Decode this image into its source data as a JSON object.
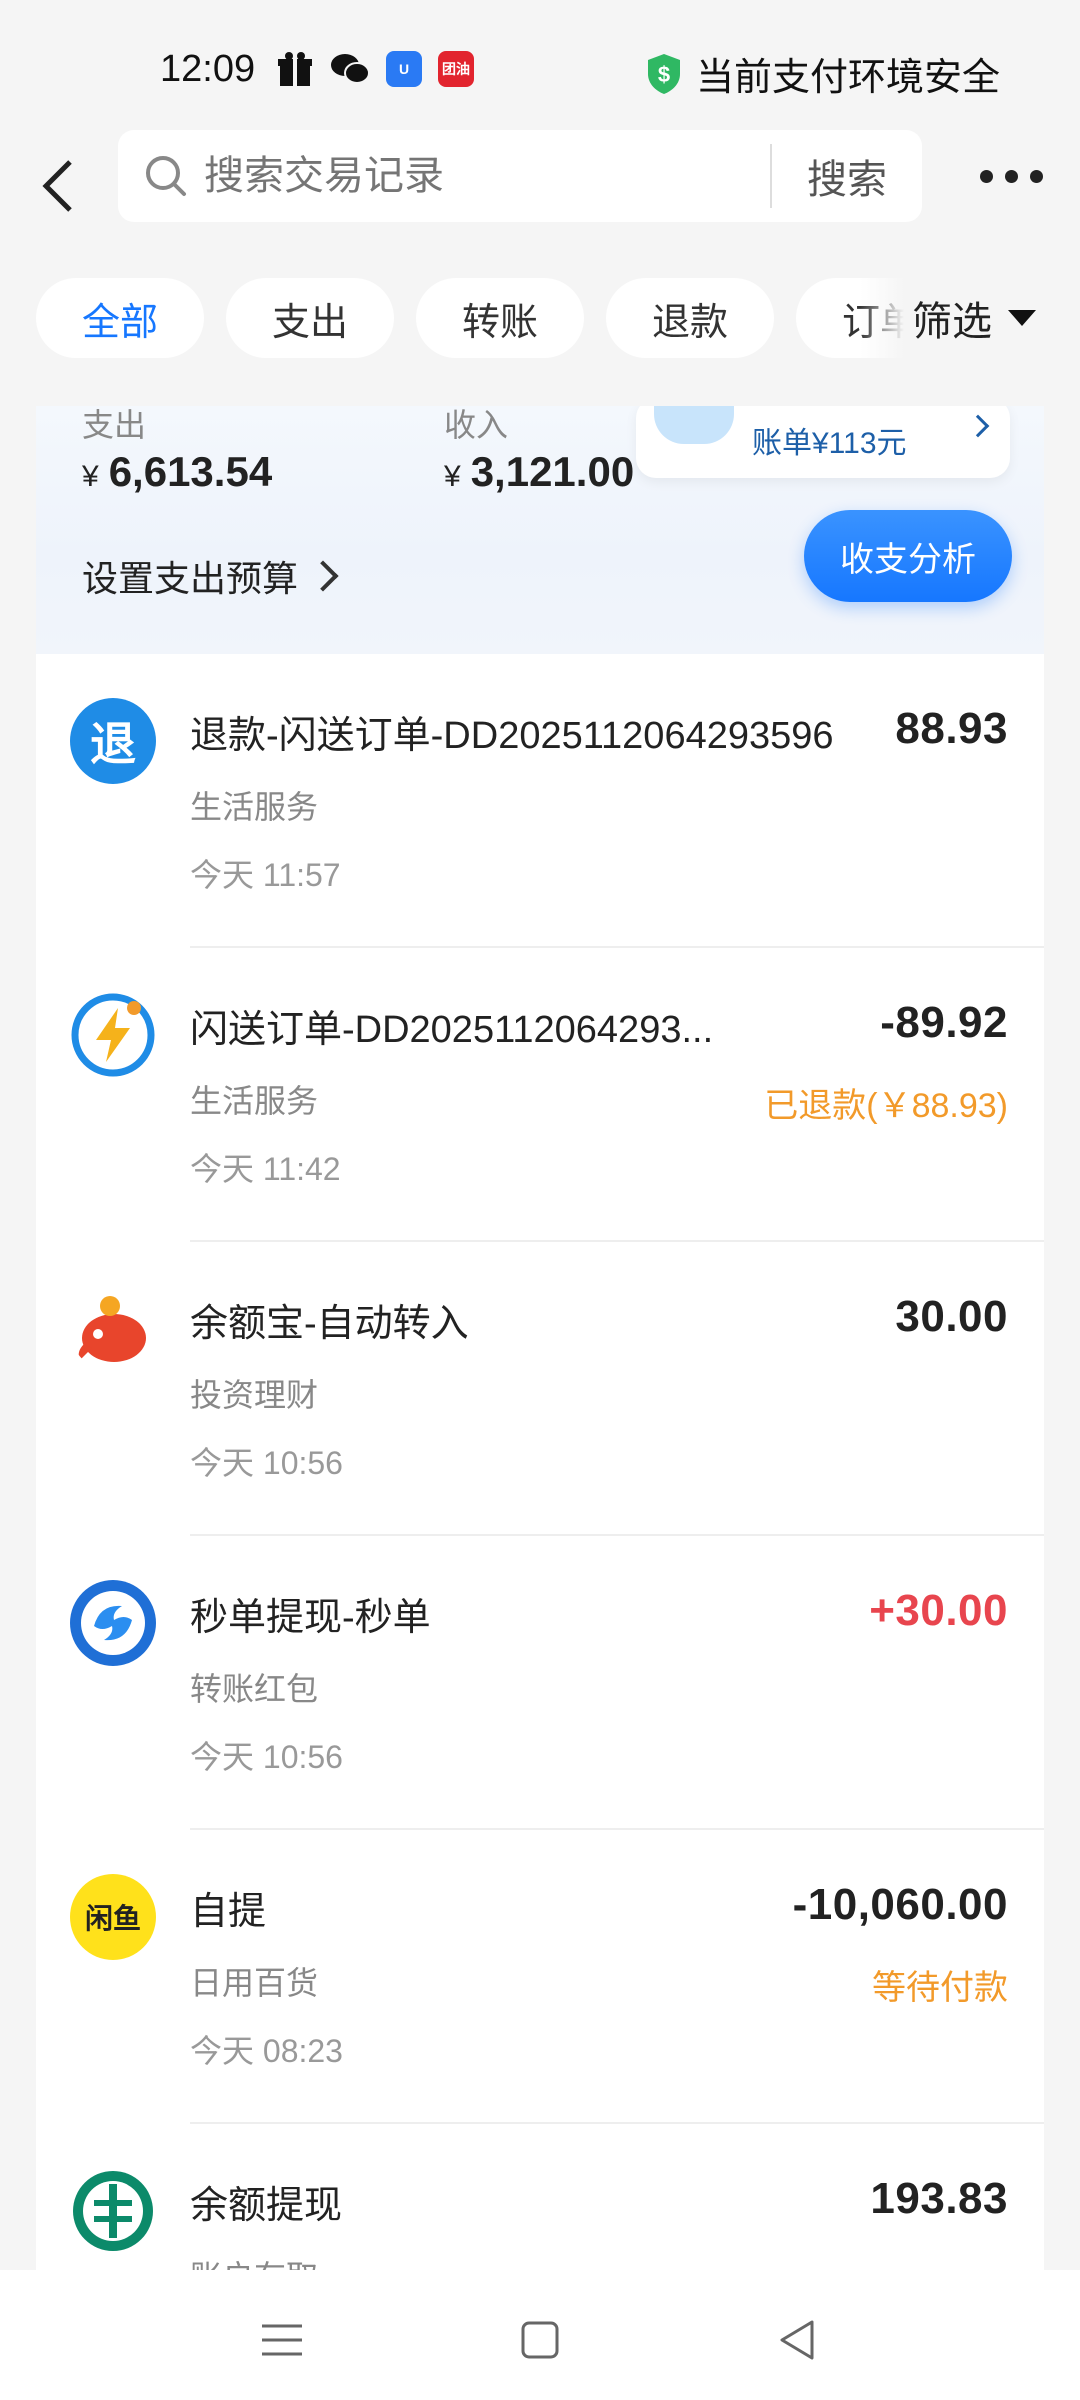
{
  "status_bar": {
    "time": "12:09",
    "icons": [
      "gift-icon",
      "wechat-icon",
      "app-icon",
      "tuanyou-icon"
    ],
    "tuanyou_label": "团油",
    "safety_text": "当前支付环境安全",
    "safety_color": "#2fb863"
  },
  "header": {
    "search_placeholder": "搜索交易记录",
    "search_button": "搜索"
  },
  "tabs": [
    {
      "label": "全部",
      "active": true
    },
    {
      "label": "支出",
      "active": false
    },
    {
      "label": "转账",
      "active": false
    },
    {
      "label": "退款",
      "active": false
    },
    {
      "label": "订单",
      "active": false
    }
  ],
  "filter_label": "筛选",
  "summary": {
    "expense_label": "支出",
    "expense_value": "6,613.54",
    "income_label": "收入",
    "income_value": "3,121.00",
    "currency": "¥",
    "budget_label": "设置支出预算",
    "tip_text": "账单¥113元",
    "analysis_button": "收支分析"
  },
  "transactions": [
    {
      "icon": "refund-icon",
      "icon_text": "退",
      "title": "退款-闪送订单-DD2025112064293596",
      "category": "生活服务",
      "time": "今天 11:57",
      "amount": "88.93",
      "status": "",
      "amount_color": "default"
    },
    {
      "icon": "flash-delivery-icon",
      "title": "闪送订单-DD2025112064293...",
      "category": "生活服务",
      "time": "今天 11:42",
      "amount": "-89.92",
      "status": "已退款(￥88.93)",
      "amount_color": "default"
    },
    {
      "icon": "yuebao-icon",
      "title": "余额宝-自动转入",
      "category": "投资理财",
      "time": "今天 10:56",
      "amount": "30.00",
      "status": "",
      "amount_color": "default"
    },
    {
      "icon": "miaodan-icon",
      "title": "秒单提现-秒单",
      "category": "转账红包",
      "time": "今天 10:56",
      "amount": "+30.00",
      "status": "",
      "amount_color": "red"
    },
    {
      "icon": "xianyu-icon",
      "icon_text": "闲鱼",
      "title": "自提",
      "category": "日用百货",
      "time": "今天 08:23",
      "amount": "-10,060.00",
      "status": "等待付款",
      "amount_color": "default"
    },
    {
      "icon": "abc-bank-icon",
      "title": "余额提现",
      "category": "账户存取",
      "time": "",
      "amount": "193.83",
      "status": "",
      "amount_color": "default"
    }
  ],
  "colors": {
    "accent": "#1677ff",
    "income_red": "#e8454e",
    "warning_orange": "#f29a2a"
  }
}
